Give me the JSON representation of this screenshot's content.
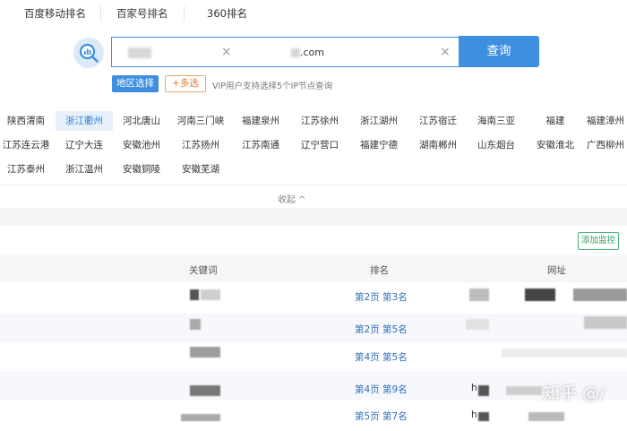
{
  "top_tabs": [
    "百度移动排名",
    "百家号排名",
    "360排名"
  ],
  "search": {
    "domain_value": ".com",
    "clear_symbol": "×",
    "query_label": "查询"
  },
  "options": {
    "region_select_label": "地区选择",
    "multi_select_label": "+多选",
    "vip_note": "VIP用户支持选择5个IP节点查询"
  },
  "regions": [
    "陕西渭南",
    "浙江衢州",
    "河北唐山",
    "河南三门峡",
    "福建泉州",
    "江苏徐州",
    "浙江湖州",
    "江苏宿迁",
    "海南三亚",
    "福建",
    "福建漳州",
    "江苏连云港",
    "辽宁大连",
    "安徽池州",
    "江苏扬州",
    "江苏南通",
    "辽宁营口",
    "福建宁德",
    "湖南郴州",
    "山东烟台",
    "安徽淮北",
    "广西柳州",
    "江苏泰州",
    "浙江温州",
    "安徽铜陵",
    "安徽芜湖"
  ],
  "active_region": "浙江衢州",
  "collapse_label": "收起 ^",
  "results": {
    "add_monitor_label": "添加监控",
    "columns": {
      "keyword": "关键词",
      "rank": "排名",
      "url": "网址"
    },
    "rows": [
      {
        "rank": "第2页 第3名"
      },
      {
        "rank": "第2页 第5名"
      },
      {
        "rank": "第4页 第5名"
      },
      {
        "rank": "第4页 第9名",
        "url_prefix": "h"
      },
      {
        "rank": "第5页 第7名",
        "url_prefix": "h"
      }
    ]
  },
  "watermark": "知乎 @/",
  "colors": {
    "accent": "#3f8fe0",
    "monitor_green": "#2e9d62",
    "link_blue": "#2f6db8",
    "orange": "#e07a30"
  }
}
